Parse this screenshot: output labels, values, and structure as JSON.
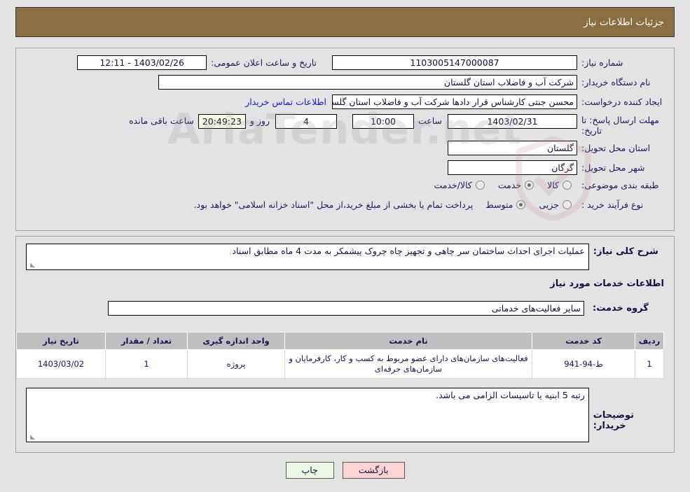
{
  "header": {
    "title": "جزئیات اطلاعات نیاز"
  },
  "watermark": {
    "text": "AriaTender.net"
  },
  "top_section": {
    "need_number_label": "شماره نیاز:",
    "need_number_value": "1103005147000087",
    "announce_datetime_label": "تاریخ و ساعت اعلان عمومی:",
    "announce_datetime_value": "1403/02/26 - 12:11",
    "buyer_org_label": "نام دستگاه خریدار:",
    "buyer_org_value": "شرکت آب و فاضلاب استان گلستان",
    "requester_label": "ایجاد کننده درخواست:",
    "requester_value": "محسن جنتی کارشناس قرار دادها شرکت آب و فاضلاب استان گلستان",
    "contact_link": "اطلاعات تماس خریدار",
    "deadline_label": "مهلت ارسال پاسخ: تا تاریخ:",
    "deadline_date": "1403/02/31",
    "deadline_hour_label": "ساعت",
    "deadline_hour_value": "10:00",
    "remaining_days": "4",
    "days_and_label": "روز و",
    "remaining_timer": "20:49:23",
    "hours_remaining_label": "ساعت باقی مانده",
    "province_label": "استان محل تحویل:",
    "province_value": "گلستان",
    "city_label": "شهر محل تحویل:",
    "city_value": "گرگان",
    "category_label": "طبقه بندی موضوعی:",
    "category_options": [
      {
        "label": "کالا",
        "selected": false
      },
      {
        "label": "خدمت",
        "selected": true
      },
      {
        "label": "کالا/خدمت",
        "selected": false
      }
    ],
    "process_type_label": "نوع فرآیند خرید :",
    "process_type_options": [
      {
        "label": "جزیی",
        "selected": false
      },
      {
        "label": "متوسط",
        "selected": true
      }
    ],
    "treasury_note": "پرداخت تمام یا بخشی از مبلغ خرید،از محل \"اسناد خزانه اسلامی\" خواهد بود."
  },
  "middle_section": {
    "general_desc_label": "شرح کلی نیاز:",
    "general_desc_value": "عملیات اجرای احداث ساختمان سر چاهی و تجهیز چاه چروک پیشمکر به مدت 4 ماه مطابق اسناد",
    "services_heading": "اطلاعات خدمات مورد نیاز",
    "service_group_label": "گروه خدمت:",
    "service_group_value": "سایر فعالیت‌های خدماتی",
    "table": {
      "headers": [
        "ردیف",
        "کد خدمت",
        "نام خدمت",
        "واحد اندازه گیری",
        "تعداد / مقدار",
        "تاریخ نیاز"
      ],
      "rows": [
        {
          "index": "1",
          "service_code": "ط-94-941",
          "service_name": "فعالیت‌های سازمان‌های دارای عضو مربوط به کسب و کار، کارفرمایان و سازمان‌های حرفه‌ای",
          "unit": "پروژه",
          "quantity": "1",
          "need_date": "1403/03/02"
        }
      ]
    },
    "buyer_notes_label": "توضیحات خریدار:",
    "buyer_notes_value": "رتبه 5 ابنیه یا تاسیسات الزامی می باشد."
  },
  "footer": {
    "print_label": "چاپ",
    "back_label": "بازگشت"
  }
}
